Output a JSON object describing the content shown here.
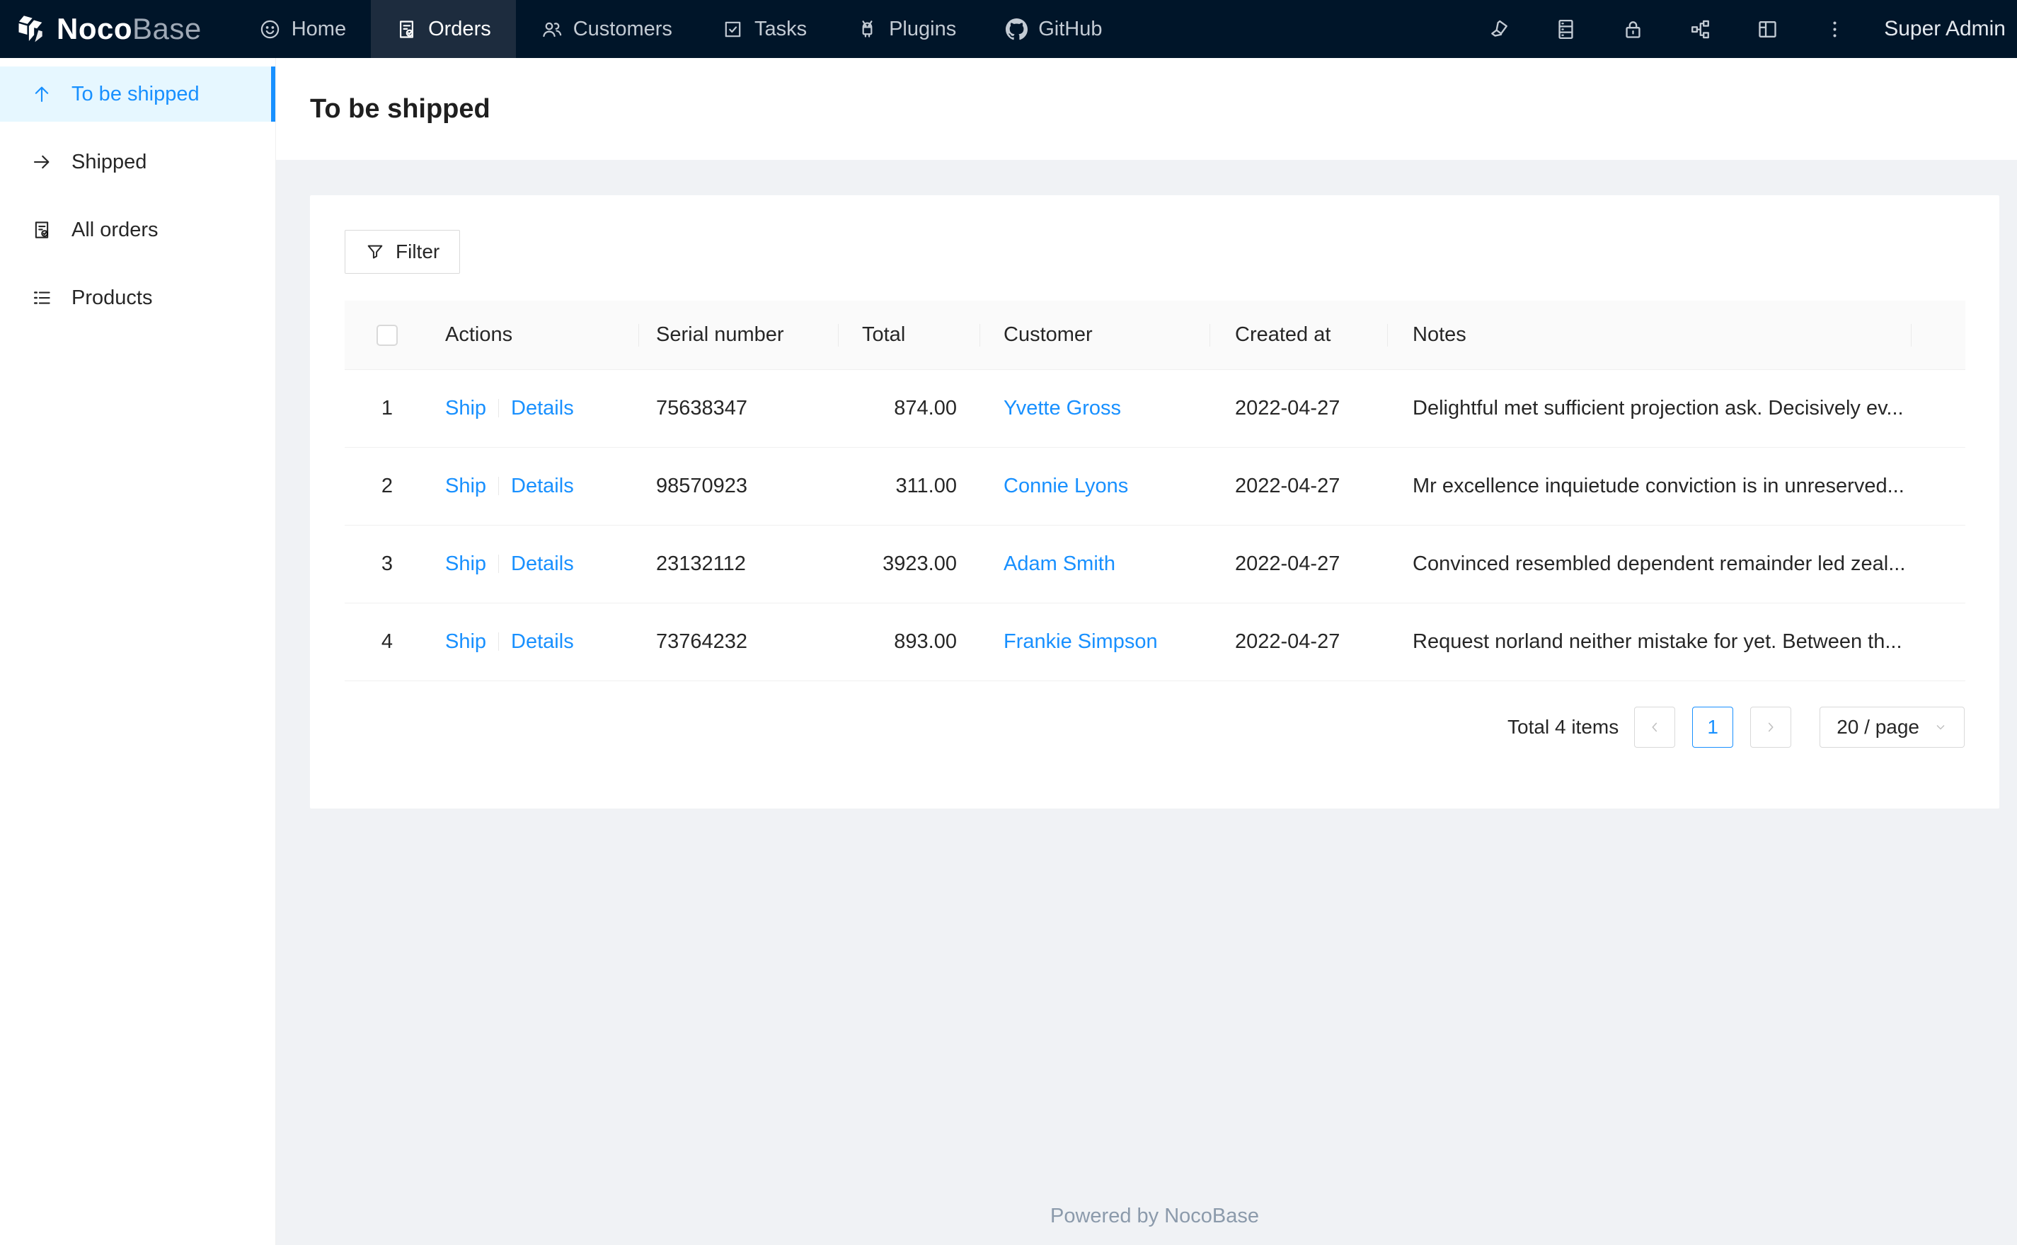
{
  "navbar": {
    "logo": {
      "noco": "Noco",
      "base": "Base"
    },
    "items": [
      {
        "label": "Home",
        "icon": "smile-icon",
        "active": false
      },
      {
        "label": "Orders",
        "icon": "file-done-icon",
        "active": true
      },
      {
        "label": "Customers",
        "icon": "team-icon",
        "active": false
      },
      {
        "label": "Tasks",
        "icon": "check-square-icon",
        "active": false
      },
      {
        "label": "Plugins",
        "icon": "android-icon",
        "active": false
      },
      {
        "label": "GitHub",
        "icon": "github-icon",
        "active": false
      }
    ],
    "action_icons": [
      "highlighter-icon",
      "database-icon",
      "lock-icon",
      "cluster-icon",
      "layout-icon",
      "more-vertical-icon"
    ],
    "user": "Super Admin"
  },
  "sidebar": {
    "items": [
      {
        "label": "To be shipped",
        "icon": "arrow-up-icon",
        "active": true
      },
      {
        "label": "Shipped",
        "icon": "arrow-right-icon",
        "active": false
      },
      {
        "label": "All orders",
        "icon": "file-done-icon",
        "active": false
      },
      {
        "label": "Products",
        "icon": "list-icon",
        "active": false
      }
    ]
  },
  "page": {
    "title": "To be shipped"
  },
  "toolbar": {
    "filter_label": "Filter"
  },
  "table": {
    "columns": [
      "",
      "Actions",
      "Serial number",
      "Total",
      "Customer",
      "Created at",
      "Notes"
    ],
    "row_actions": [
      "Ship",
      "Details"
    ],
    "rows": [
      {
        "index": "1",
        "serial": "75638347",
        "total": "874.00",
        "customer": "Yvette Gross",
        "created_at": "2022-04-27",
        "notes": "Delightful met sufficient projection ask. Decisively ev..."
      },
      {
        "index": "2",
        "serial": "98570923",
        "total": "311.00",
        "customer": "Connie Lyons",
        "created_at": "2022-04-27",
        "notes": "Mr excellence inquietude conviction is in unreserved..."
      },
      {
        "index": "3",
        "serial": "23132112",
        "total": "3923.00",
        "customer": "Adam Smith",
        "created_at": "2022-04-27",
        "notes": "Convinced resembled dependent remainder led zeal..."
      },
      {
        "index": "4",
        "serial": "73764232",
        "total": "893.00",
        "customer": "Frankie Simpson",
        "created_at": "2022-04-27",
        "notes": "Request norland neither mistake for yet. Between th..."
      }
    ]
  },
  "pagination": {
    "total_text": "Total 4 items",
    "current_page": "1",
    "page_size": "20 / page"
  },
  "footer": {
    "text": "Powered by NocoBase"
  },
  "colors": {
    "accent": "#1890ff",
    "navbar_bg": "#001529",
    "nav_active_bg": "#1d2c3e",
    "sidebar_active_bg": "#e6f7ff",
    "page_bg": "#f0f2f5",
    "table_header_bg": "#fafafa"
  }
}
